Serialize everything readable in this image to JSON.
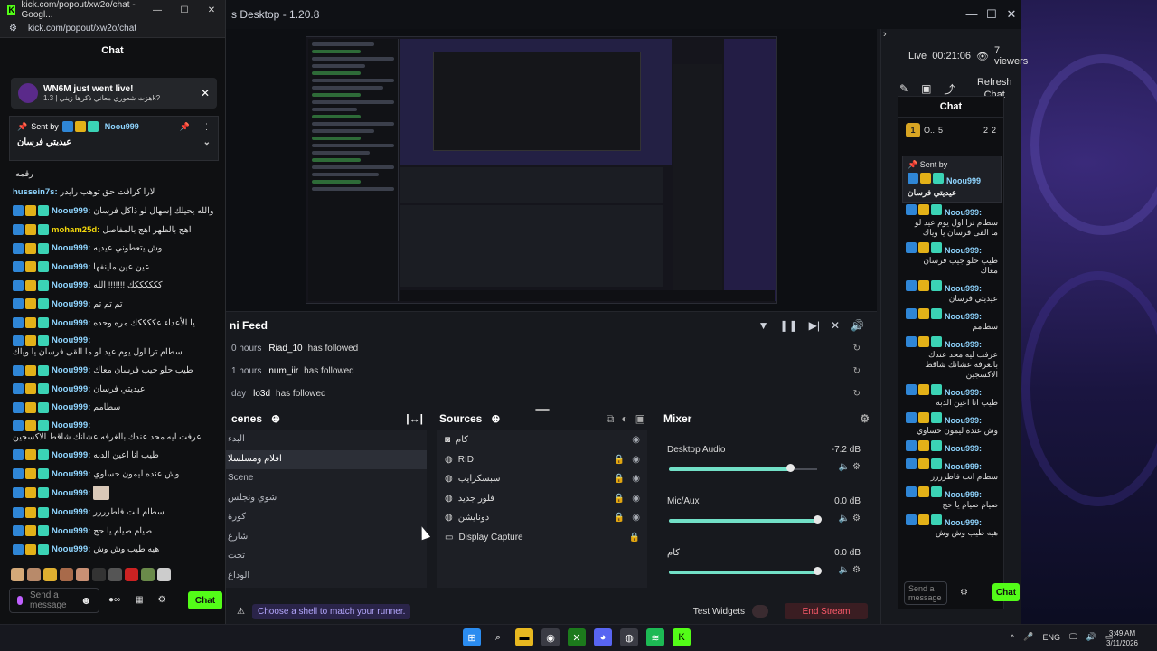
{
  "obs": {
    "title": "s Desktop - 1.20.8",
    "live_label": "Live",
    "live_time": "00:21:06",
    "viewers": "7 viewers",
    "refresh_chat": "Refresh Chat",
    "feed": {
      "title": "ni Feed",
      "items": [
        {
          "time": "0 hours",
          "user": "Riad_10",
          "action": "has followed"
        },
        {
          "time": "1 hours",
          "user": "num_iir",
          "action": "has followed"
        },
        {
          "time": "day",
          "user": "lo3d",
          "action": "has followed"
        }
      ]
    },
    "scenes": {
      "title": "cenes",
      "items": [
        "البدء",
        "افلام ومسلسلا",
        "Scene",
        "شوي ونجلس",
        "كورة",
        "شارع",
        "تحت",
        "الوداع"
      ],
      "active_index": 1
    },
    "sources": {
      "title": "Sources",
      "items": [
        {
          "icon": "camera",
          "name": "كام"
        },
        {
          "icon": "globe",
          "name": "RID"
        },
        {
          "icon": "globe",
          "name": "سبسكرايب"
        },
        {
          "icon": "globe",
          "name": "فلور جديد"
        },
        {
          "icon": "globe",
          "name": "دونايشن"
        },
        {
          "icon": "monitor",
          "name": "Display Capture"
        }
      ]
    },
    "mixer": {
      "title": "Mixer",
      "channels": [
        {
          "name": "Desktop Audio",
          "db": "-7.2 dB",
          "level": 0.82
        },
        {
          "name": "Mic/Aux",
          "db": "0.0 dB",
          "level": 1.0
        },
        {
          "name": "كام",
          "db": "0.0 dB",
          "level": 1.0
        }
      ]
    },
    "status_tip": "Choose a shell to match your runner.",
    "test_widgets": "Test Widgets",
    "end_stream": "End Stream",
    "mini_chat": {
      "title": "Chat",
      "leader_name": "O..",
      "leader_rank": "1",
      "leader_score_a": "2",
      "leader_score_b": "2",
      "leader_count": "5",
      "pinned_label": "Sent by",
      "pinned_user": "Noou999",
      "pinned_msg": "عيديتي فرسان",
      "messages": [
        {
          "user": "Noou999:",
          "text": "سطام ترا اول يوم عيد لو ما القى فرسان يا وياك"
        },
        {
          "user": "Noou999:",
          "text": "طيب حلو جيب فرسان معاك"
        },
        {
          "user": "Noou999:",
          "text": "عيديتي فرسان"
        },
        {
          "user": "Noou999:",
          "text": "سطامم"
        },
        {
          "user": "Noou999:",
          "text": "عرفت ليه محد عندك بالغرفه عشانك شاقط الاكسجين"
        },
        {
          "user": "Noou999:",
          "text": "طيب انا اعين الدبه"
        },
        {
          "user": "Noou999:",
          "text": "وش عنده ليمون حساوي"
        },
        {
          "user": "Noou999:",
          "text": ""
        },
        {
          "user": "Noou999:",
          "text": "سطام انت فاطرررر"
        },
        {
          "user": "Noou999:",
          "text": "صيام صيام يا حج"
        },
        {
          "user": "Noou999:",
          "text": "هيه طيب وش وش"
        }
      ],
      "input_placeholder": "Send a message",
      "chat_button": "Chat"
    }
  },
  "chrome": {
    "title": "kick.com/popout/xw2o/chat - Googl...",
    "url": "kick.com/popout/xw2o/chat",
    "chat_heading": "Chat",
    "toast_title": "WN6M just went live!",
    "toast_sub": "هزت شعوري معاني ذكرها زيني | 1.3k?",
    "pinned_label": "Sent by",
    "pinned_user": "Noou999",
    "pinned_msg": "عيديتي فرسان",
    "messages": [
      {
        "user": "",
        "color": "#8fd5ff",
        "text": "رقمه",
        "badges": false
      },
      {
        "user": "hussein7s:",
        "color": "#8fd5ff",
        "text": "لارا كرافت حق توهب رايدر",
        "badges": false
      },
      {
        "user": "Noou999:",
        "color": "#8fd5ff",
        "text": "والله يحيلك إسهال لو ذاكل فرسان",
        "badges": true
      },
      {
        "user": "moham25d:",
        "color": "#f5d90a",
        "text": "اهج بالظهر اهج بالمفاصل",
        "badges": true
      },
      {
        "user": "Noou999:",
        "color": "#8fd5ff",
        "text": "وش يتعطوني عيديه",
        "badges": true
      },
      {
        "user": "Noou999:",
        "color": "#8fd5ff",
        "text": "عين عين ماينفها",
        "badges": true
      },
      {
        "user": "Noou999:",
        "color": "#8fd5ff",
        "text": "ككككككك !!!!!!! الله",
        "badges": true
      },
      {
        "user": "Noou999:",
        "color": "#8fd5ff",
        "text": "تم تم تم",
        "badges": true
      },
      {
        "user": "Noou999:",
        "color": "#8fd5ff",
        "text": "يا الأعداء عككككك مره وحده",
        "badges": true
      },
      {
        "user": "Noou999:",
        "color": "#8fd5ff",
        "text": "سطام ترا اول يوم عيد لو ما القى فرسان يا وياك",
        "badges": true
      },
      {
        "user": "Noou999:",
        "color": "#8fd5ff",
        "text": "طيب حلو جيب فرسان معاك",
        "badges": true
      },
      {
        "user": "Noou999:",
        "color": "#8fd5ff",
        "text": "عيديتي فرسان",
        "badges": true
      },
      {
        "user": "Noou999:",
        "color": "#8fd5ff",
        "text": "سطامم",
        "badges": true
      },
      {
        "user": "Noou999:",
        "color": "#8fd5ff",
        "text": "عرفت ليه محد عندك بالغرفه عشانك شاقط الاكسجين",
        "badges": true
      },
      {
        "user": "Noou999:",
        "color": "#8fd5ff",
        "text": "طيب انا اعين الدبه",
        "badges": true
      },
      {
        "user": "Noou999:",
        "color": "#8fd5ff",
        "text": "وش عنده ليمون حساوي",
        "badges": true
      },
      {
        "user": "Noou999:",
        "color": "#8fd5ff",
        "text": "",
        "badges": true,
        "emote": true
      },
      {
        "user": "Noou999:",
        "color": "#8fd5ff",
        "text": "سطام انت فاطرررر",
        "badges": true
      },
      {
        "user": "Noou999:",
        "color": "#8fd5ff",
        "text": "صيام صيام يا حج",
        "badges": true
      },
      {
        "user": "Noou999:",
        "color": "#8fd5ff",
        "text": "هيه طيب وش وش",
        "badges": true
      }
    ],
    "input_placeholder": "Send a message",
    "chat_button": "Chat"
  },
  "taskbar": {
    "tray_lang": "ENG",
    "time": "3:49 AM",
    "date": "3/11/2026"
  },
  "colors": {
    "kick_green": "#53fc18",
    "live_red": "#e53935",
    "accent_teal": "#72e0c7"
  }
}
